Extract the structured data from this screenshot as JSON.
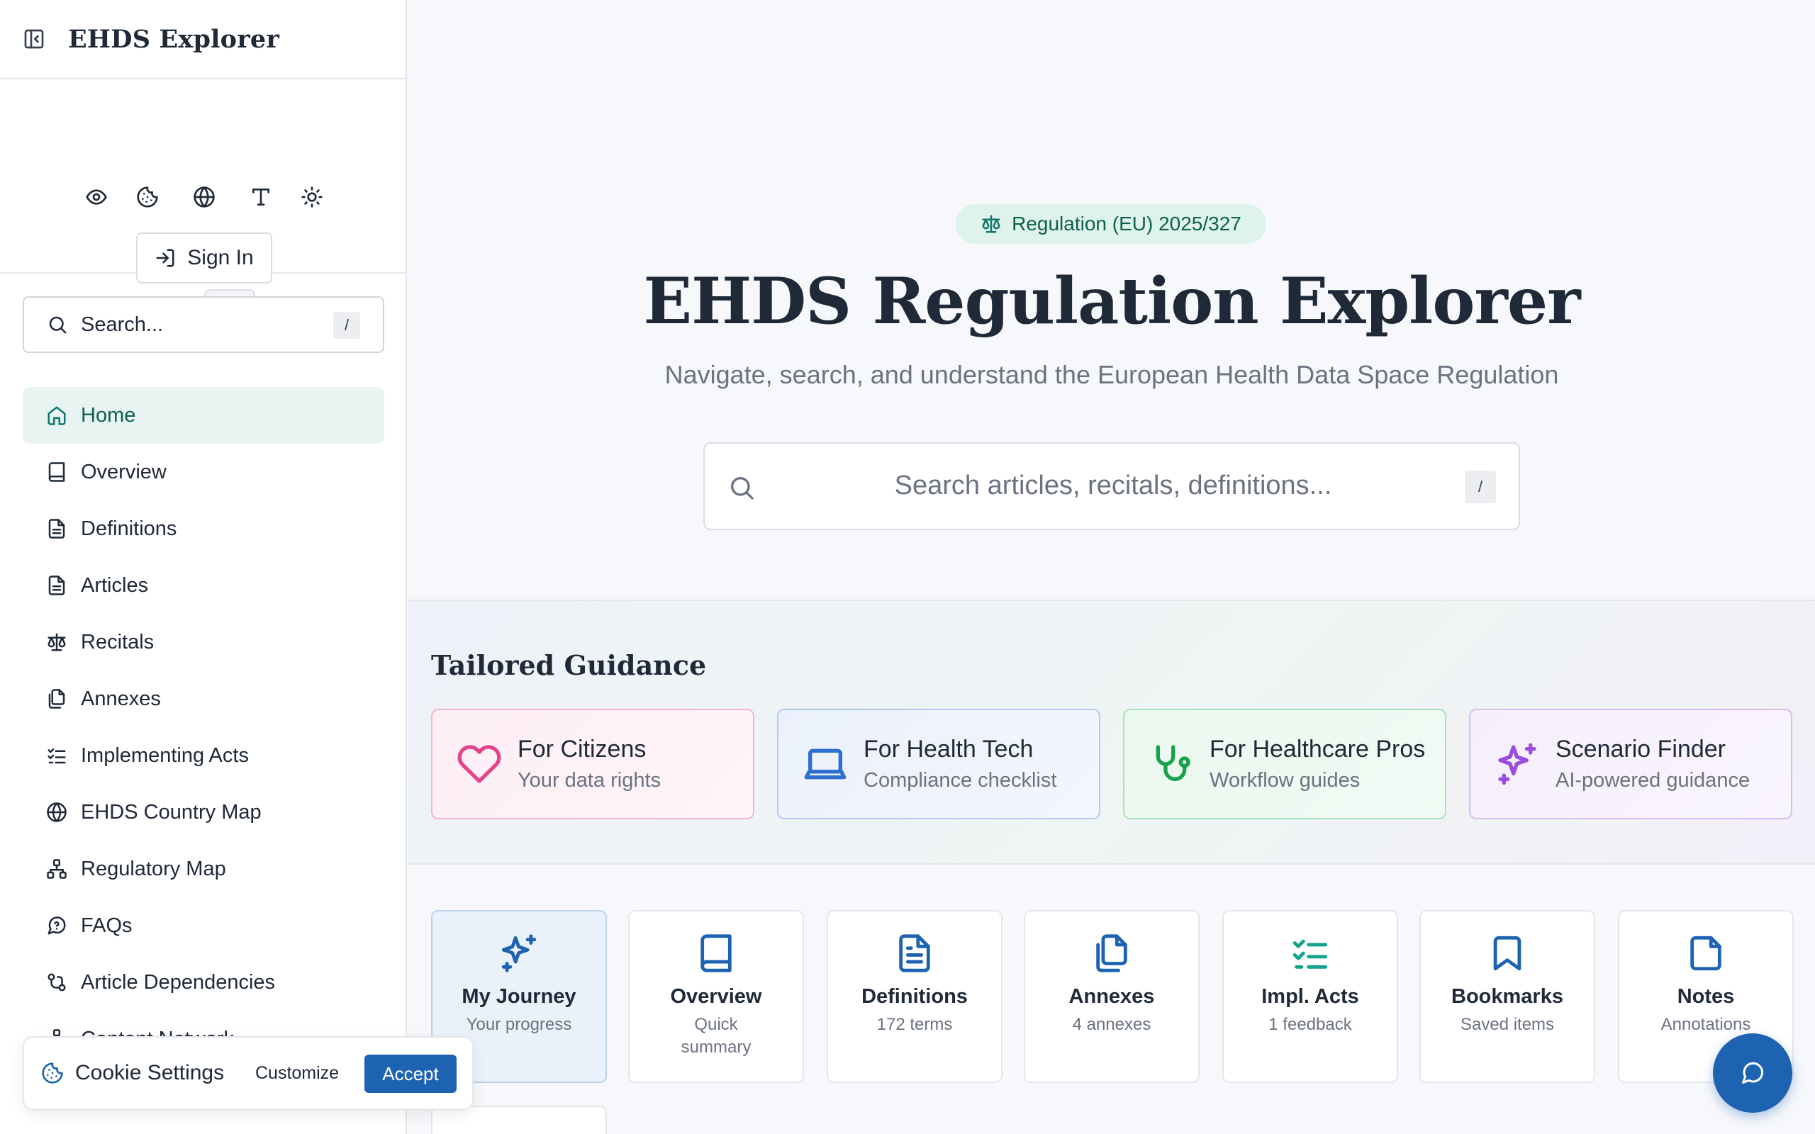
{
  "sidebar": {
    "title": "EHDS Explorer",
    "sign_in_label": "Sign In",
    "search_placeholder": "Search...",
    "search_shortcut": "/",
    "nav": [
      {
        "label": "Home",
        "icon": "home-icon",
        "active": true
      },
      {
        "label": "Overview",
        "icon": "book-icon"
      },
      {
        "label": "Definitions",
        "icon": "document-icon"
      },
      {
        "label": "Articles",
        "icon": "document-icon"
      },
      {
        "label": "Recitals",
        "icon": "scale-icon"
      },
      {
        "label": "Annexes",
        "icon": "files-icon"
      },
      {
        "label": "Implementing Acts",
        "icon": "checklist-icon"
      },
      {
        "label": "EHDS Country Map",
        "icon": "globe-icon"
      },
      {
        "label": "Regulatory Map",
        "icon": "network-icon"
      },
      {
        "label": "FAQs",
        "icon": "help-bubble-icon"
      },
      {
        "label": "Article Dependencies",
        "icon": "git-compare-icon"
      },
      {
        "label": "Content Network",
        "icon": "network-icon"
      }
    ]
  },
  "cookie": {
    "title": "Cookie Settings",
    "customize_label": "Customize",
    "accept_label": "Accept"
  },
  "hero": {
    "badge": "Regulation (EU) 2025/327",
    "title": "EHDS Regulation Explorer",
    "subtitle": "Navigate, search, and understand the European Health Data Space Regulation",
    "search_placeholder": "Search articles, recitals, definitions...",
    "search_shortcut": "/"
  },
  "guidance": {
    "title": "Tailored Guidance",
    "cards": [
      {
        "title": "For Citizens",
        "subtitle": "Your data rights",
        "icon": "heart-icon",
        "color": "#e2458a"
      },
      {
        "title": "For Health Tech",
        "subtitle": "Compliance checklist",
        "icon": "laptop-icon",
        "color": "#2b6fd1"
      },
      {
        "title": "For Healthcare Pros",
        "subtitle": "Workflow guides",
        "icon": "stethoscope-icon",
        "color": "#17a34a"
      },
      {
        "title": "Scenario Finder",
        "subtitle": "AI-powered guidance",
        "icon": "sparkles-icon",
        "color": "#9b4de0"
      }
    ]
  },
  "quick": [
    {
      "title": "My Journey",
      "subtitle": "Your progress",
      "icon": "sparkles-icon"
    },
    {
      "title": "Overview",
      "subtitle": "Quick summary",
      "icon": "book-icon"
    },
    {
      "title": "Definitions",
      "subtitle": "172 terms",
      "icon": "document-icon"
    },
    {
      "title": "Annexes",
      "subtitle": "4 annexes",
      "icon": "files-icon"
    },
    {
      "title": "Impl. Acts",
      "subtitle": "1 feedback",
      "icon": "checklist-icon"
    },
    {
      "title": "Bookmarks",
      "subtitle": "Saved items",
      "icon": "bookmark-icon"
    },
    {
      "title": "Notes",
      "subtitle": "Annotations",
      "icon": "note-icon"
    }
  ],
  "colors": {
    "primary": "#1d63b1",
    "accent_green": "#0f766e",
    "active_bg": "#e8f4f1"
  }
}
